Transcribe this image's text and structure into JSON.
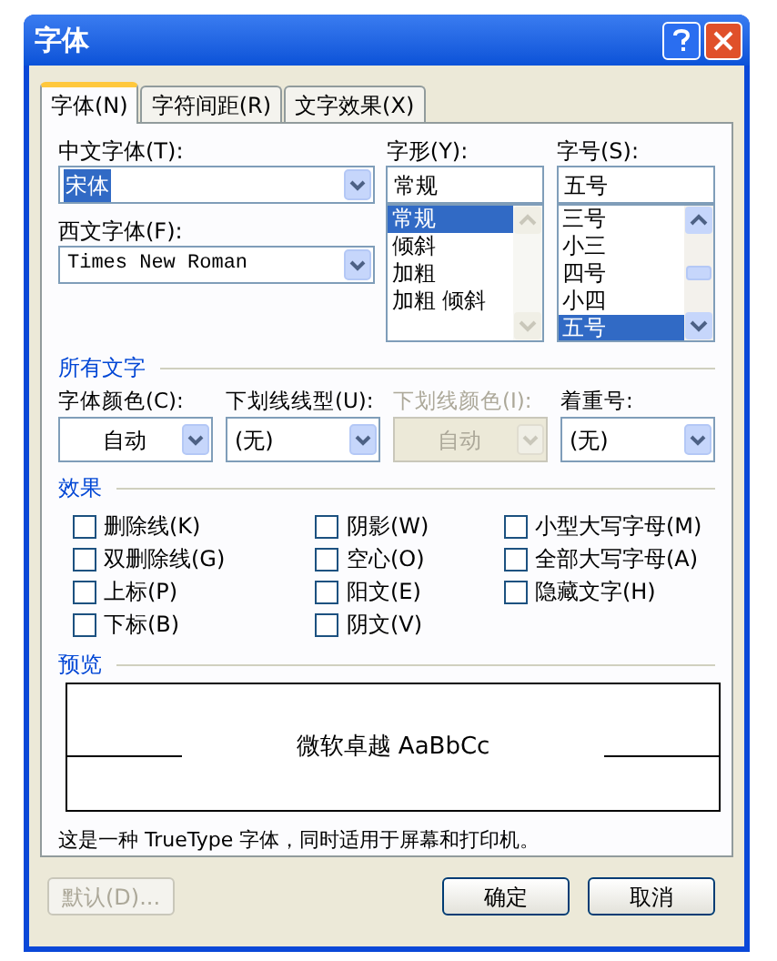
{
  "window": {
    "title": "字体"
  },
  "tabs": [
    {
      "label": "字体(N)",
      "selected": true
    },
    {
      "label": "字符间距(R)",
      "selected": false
    },
    {
      "label": "文字效果(X)",
      "selected": false
    }
  ],
  "chinese_font": {
    "label": "中文字体(T):",
    "value": "宋体"
  },
  "western_font": {
    "label": "西文字体(F):",
    "value": "Times New Roman"
  },
  "font_style": {
    "label": "字形(Y):",
    "value": "常规",
    "items": [
      {
        "label": "常规",
        "selected": true
      },
      {
        "label": "倾斜",
        "selected": false
      },
      {
        "label": "加粗",
        "selected": false
      },
      {
        "label": "加粗 倾斜",
        "selected": false
      }
    ]
  },
  "font_size": {
    "label": "字号(S):",
    "value": "五号",
    "items": [
      {
        "label": "三号",
        "selected": false
      },
      {
        "label": "小三",
        "selected": false
      },
      {
        "label": "四号",
        "selected": false
      },
      {
        "label": "小四",
        "selected": false
      },
      {
        "label": "五号",
        "selected": true
      }
    ]
  },
  "all_text": {
    "heading": "所有文字",
    "fields": [
      {
        "label": "字体颜色(C):",
        "value": "自动",
        "disabled": false,
        "centered": true
      },
      {
        "label": "下划线线型(U):",
        "value": "(无)",
        "disabled": false,
        "centered": false
      },
      {
        "label": "下划线颜色(I):",
        "value": "自动",
        "disabled": true,
        "centered": true
      },
      {
        "label": "着重号:",
        "value": "(无)",
        "disabled": false,
        "centered": false
      }
    ]
  },
  "effects": {
    "heading": "效果",
    "columns": [
      [
        {
          "label": "删除线(K)",
          "checked": false
        },
        {
          "label": "双删除线(G)",
          "checked": false
        },
        {
          "label": "上标(P)",
          "checked": false
        },
        {
          "label": "下标(B)",
          "checked": false
        }
      ],
      [
        {
          "label": "阴影(W)",
          "checked": false
        },
        {
          "label": "空心(O)",
          "checked": false
        },
        {
          "label": "阳文(E)",
          "checked": false
        },
        {
          "label": "阴文(V)",
          "checked": false
        }
      ],
      [
        {
          "label": "小型大写字母(M)",
          "checked": false
        },
        {
          "label": "全部大写字母(A)",
          "checked": false
        },
        {
          "label": "隐藏文字(H)",
          "checked": false
        }
      ]
    ]
  },
  "preview": {
    "heading": "预览",
    "sample": "微软卓越 AaBbCc",
    "note": "这是一种 TrueType 字体，同时适用于屏幕和打印机。"
  },
  "buttons": [
    {
      "label": "默认(D)...",
      "disabled": true
    },
    {
      "label": "确定",
      "disabled": false
    },
    {
      "label": "取消",
      "disabled": false
    }
  ]
}
